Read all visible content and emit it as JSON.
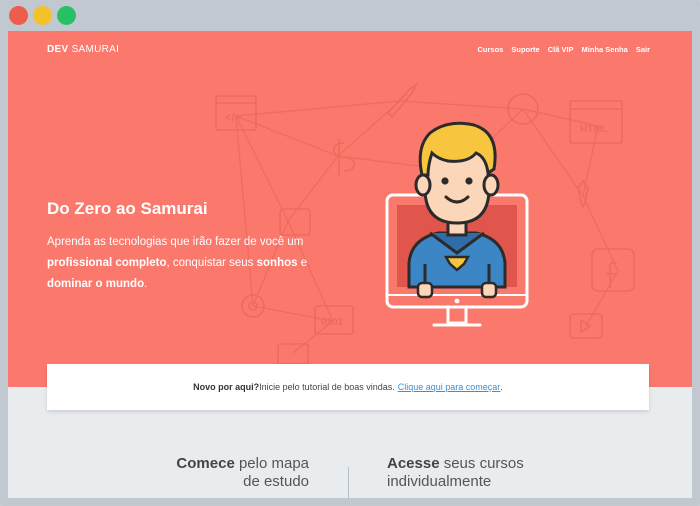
{
  "window": {
    "controls": [
      "close",
      "minimize",
      "maximize"
    ]
  },
  "header": {
    "logo_bold": "DEV",
    "logo_light": "SAMURAI",
    "nav": [
      {
        "label": "Cursos"
      },
      {
        "label": "Suporte"
      },
      {
        "label": "Clã VIP"
      },
      {
        "label": "Minha Senha"
      },
      {
        "label": "Sair"
      }
    ]
  },
  "hero": {
    "title": "Do Zero ao Samurai",
    "text_1": "Aprenda as tecnologias que irão fazer de você um ",
    "text_bold_1": "profissional completo",
    "text_2": ", conquistar seus ",
    "text_bold_2": "sonhos",
    "text_3": " e ",
    "text_bold_3": "dominar o mundo",
    "text_4": ".",
    "background_icons": [
      "code-window-icon",
      "rocket-icon",
      "github-icon",
      "html-icon",
      "dollar-icon",
      "tie-icon",
      "mic-icon",
      "facebook-icon",
      "gear-icon",
      "binary-icon",
      "play-icon",
      "computer-icon"
    ],
    "binary_label": "0101",
    "html_label": "HTML",
    "code_label": "</>"
  },
  "notice": {
    "bold": "Novo por aqui?",
    "text": " Inicie pelo tutorial de boas vindas. ",
    "link": "Clique aqui para começar",
    "end": "."
  },
  "bottom": {
    "left_bold": "Comece",
    "left_text_1": " pelo mapa",
    "left_text_2": "de estudo",
    "right_bold": "Acesse",
    "right_text_1": " seus cursos",
    "right_text_2": "individualmente"
  },
  "colors": {
    "hero_bg": "#fb786c",
    "page_bg": "#e9ecef",
    "link": "#3a8fd6",
    "hair": "#f7c63e",
    "suit": "#3d86c6"
  }
}
